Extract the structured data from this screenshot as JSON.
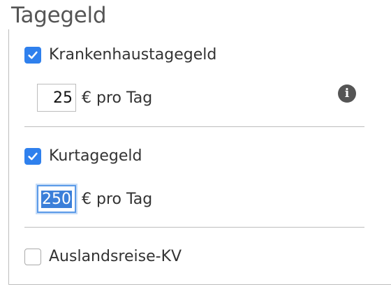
{
  "section": {
    "title": "Tagegeld"
  },
  "options": [
    {
      "label": "Krankenhaustagegeld",
      "checked": true,
      "amount": "25",
      "unit": "€ pro Tag"
    },
    {
      "label": "Kurtagegeld",
      "checked": true,
      "amount": "250",
      "unit": "€ pro Tag"
    },
    {
      "label": "Auslandsreise-KV",
      "checked": false
    }
  ],
  "icons": {
    "info": "info-icon",
    "check": "checkmark-icon"
  },
  "colors": {
    "accent": "#2f80ed",
    "title": "#555555",
    "divider": "#bdbdbd"
  }
}
